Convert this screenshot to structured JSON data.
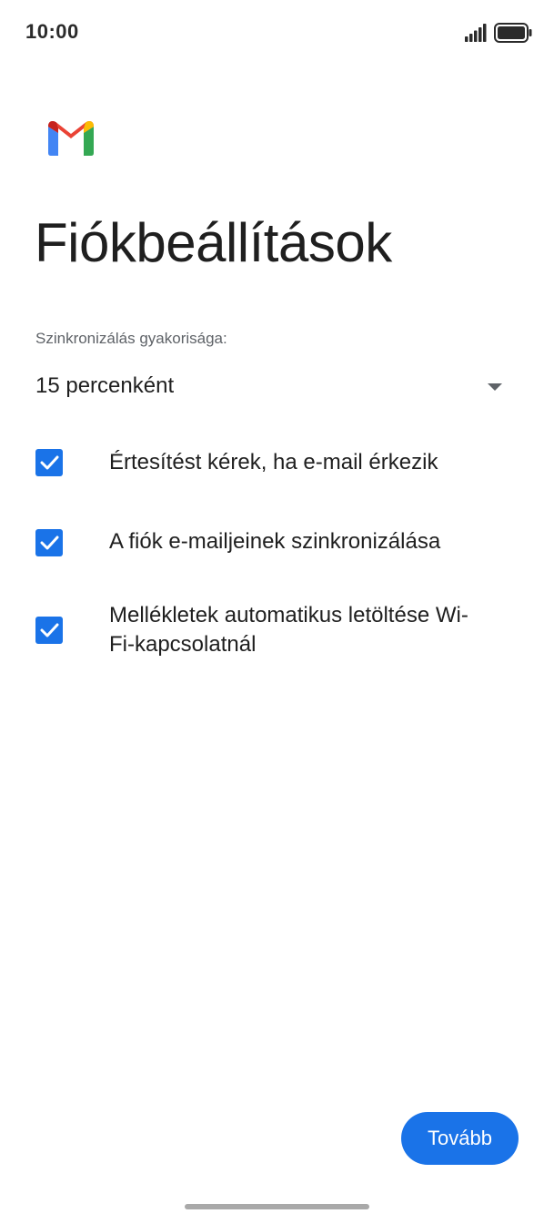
{
  "status_bar": {
    "time": "10:00",
    "icons": [
      "signal-icon",
      "battery-icon"
    ]
  },
  "app": {
    "logo": "gmail-logo",
    "colors": {
      "accent": "#1a73e8",
      "title_text": "#1f1f1f",
      "secondary_text": "#5f6368",
      "gmail_red": "#ea4335",
      "gmail_blue": "#4285f4",
      "gmail_green": "#34a853",
      "gmail_yellow": "#fbbc04"
    }
  },
  "page": {
    "title": "Fiókbeállítások"
  },
  "sync": {
    "label": "Szinkronizálás gyakorisága:",
    "selected_value": "15 percenként"
  },
  "options": [
    {
      "label": "Értesítést kérek, ha e-mail érkezik",
      "checked": true
    },
    {
      "label": "A fiók e-mailjeinek szinkronizálása",
      "checked": true
    },
    {
      "label": "Mellékletek automatikus letöltése Wi-Fi-kapcsolatnál",
      "checked": true
    }
  ],
  "footer": {
    "next_label": "Tovább"
  }
}
